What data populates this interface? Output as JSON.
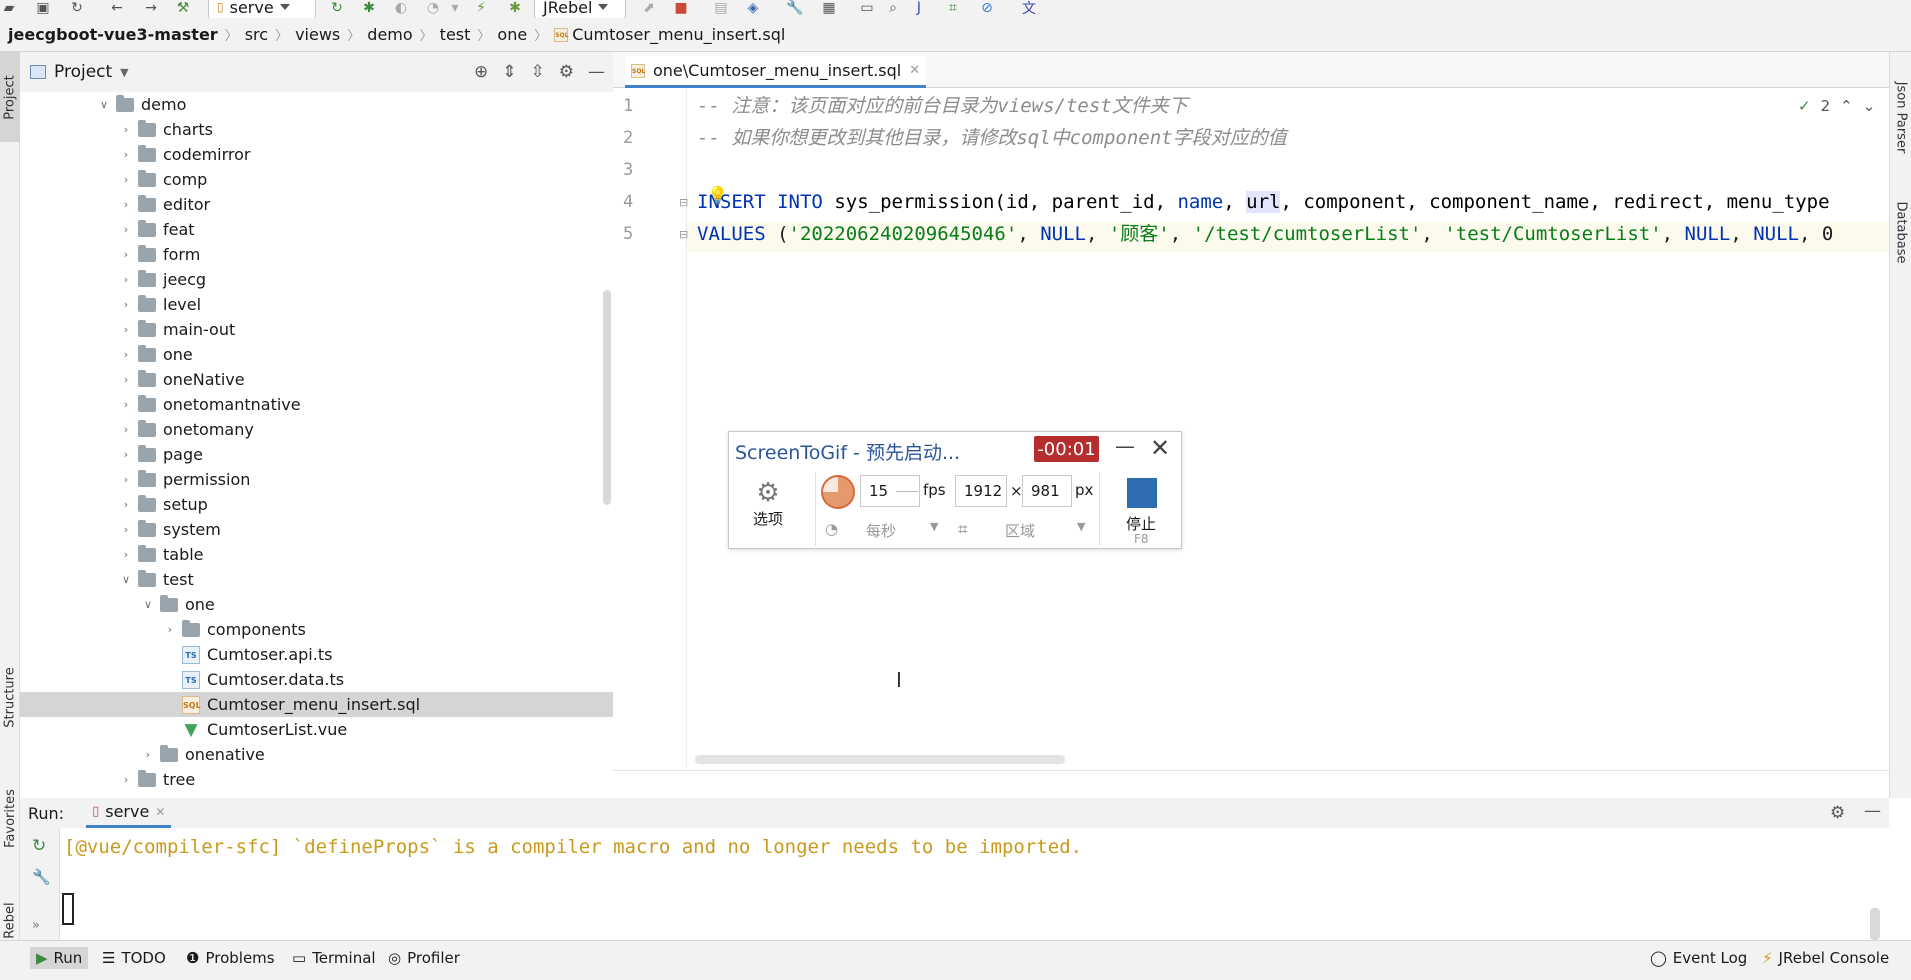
{
  "toolbar": {
    "run_config": "serve",
    "jrebel_combo": "JRebel"
  },
  "breadcrumb": [
    "jeecgboot-vue3-master",
    "src",
    "views",
    "demo",
    "test",
    "one",
    "Cumtoser_menu_insert.sql"
  ],
  "project_panel": {
    "title": "Project",
    "tree": [
      {
        "label": "demo",
        "type": "folder",
        "expanded": true
      },
      {
        "label": "charts",
        "type": "folder"
      },
      {
        "label": "codemirror",
        "type": "folder"
      },
      {
        "label": "comp",
        "type": "folder"
      },
      {
        "label": "editor",
        "type": "folder"
      },
      {
        "label": "feat",
        "type": "folder"
      },
      {
        "label": "form",
        "type": "folder"
      },
      {
        "label": "jeecg",
        "type": "folder"
      },
      {
        "label": "level",
        "type": "folder"
      },
      {
        "label": "main-out",
        "type": "folder"
      },
      {
        "label": "one",
        "type": "folder"
      },
      {
        "label": "oneNative",
        "type": "folder"
      },
      {
        "label": "onetomantnative",
        "type": "folder"
      },
      {
        "label": "onetomany",
        "type": "folder"
      },
      {
        "label": "page",
        "type": "folder"
      },
      {
        "label": "permission",
        "type": "folder"
      },
      {
        "label": "setup",
        "type": "folder"
      },
      {
        "label": "system",
        "type": "folder"
      },
      {
        "label": "table",
        "type": "folder"
      },
      {
        "label": "test",
        "type": "folder",
        "expanded": true
      },
      {
        "label": "one",
        "type": "folder",
        "expanded": true
      },
      {
        "label": "components",
        "type": "folder"
      },
      {
        "label": "Cumtoser.api.ts",
        "type": "ts"
      },
      {
        "label": "Cumtoser.data.ts",
        "type": "ts"
      },
      {
        "label": "Cumtoser_menu_insert.sql",
        "type": "sql",
        "selected": true
      },
      {
        "label": "CumtoserList.vue",
        "type": "vue"
      },
      {
        "label": "onenative",
        "type": "folder"
      },
      {
        "label": "tree",
        "type": "folder"
      }
    ]
  },
  "editor": {
    "tab_label": "one\\Cumtoser_menu_insert.sql",
    "inspections_count": "2",
    "line_numbers": [
      "1",
      "2",
      "3",
      "4",
      "5"
    ],
    "line1": "-- 注意：该页面对应的前台目录为views/test文件夹下",
    "line2": "-- 如果你想更改到其他目录，请修改sql中component字段对应的值",
    "line4": {
      "l4a": "I",
      "l4b": "NSERT",
      "l4c": " ",
      "l4d": "INTO",
      "l4e": " sys_permission(id, parent_id, ",
      "l4f": "name",
      "l4g": ", ",
      "l4h": "url",
      "l4i": ", component, component_name, redirect, menu_type"
    },
    "line5": {
      "l5a": "VALUES",
      "l5b": " (",
      "l5c": "'20220624020964504​6'",
      "l5d": ", ",
      "l5e": "NULL",
      "l5f": ", ",
      "l5g": "'顾客'",
      "l5h": ", ",
      "l5i": "'/test/cumtoserList'",
      "l5j": ", ",
      "l5k": "'test/CumtoserList'",
      "l5l": ", ",
      "l5m": "NULL",
      "l5n": ", ",
      "l5o": "NULL",
      "l5p": ", 0"
    }
  },
  "screentogif": {
    "title": "ScreenToGif - 预先启动...",
    "timer": "-00:01",
    "options_label": "选项",
    "fps_value": "15",
    "fps_unit": "fps",
    "per_second": "每秒",
    "width": "1912",
    "times": "×",
    "height": "981",
    "px_unit": "px",
    "region": "区域",
    "stop_label": "停止",
    "stop_hotkey": "F8"
  },
  "run_panel": {
    "label": "Run:",
    "tab": "serve",
    "output": "[@vue/compiler-sfc] `defineProps` is a compiler macro and no longer needs to be imported."
  },
  "left_strip": {
    "project": "Project",
    "structure": "Structure",
    "favorites": "Favorites",
    "jrebel": "JRebel"
  },
  "right_strip": {
    "json_parser": "Json Parser",
    "database": "Database"
  },
  "status_bar": {
    "run": "Run",
    "todo": "TODO",
    "problems": "Problems",
    "terminal": "Terminal",
    "profiler": "Profiler",
    "event_log": "Event Log",
    "jrebel_console": "JRebel Console"
  }
}
